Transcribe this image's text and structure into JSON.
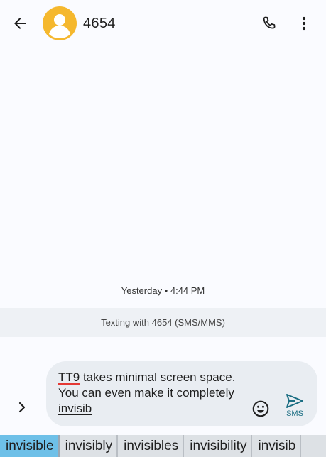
{
  "header": {
    "contact_name": "4654",
    "avatar_color": "#f5b82e",
    "icons": {
      "back": "back-arrow-icon",
      "avatar": "person-icon",
      "call": "phone-icon",
      "more": "more-vert-icon"
    }
  },
  "conversation": {
    "timestamp": "Yesterday • 4:44 PM",
    "banner": "Texting with 4654 (SMS/MMS)"
  },
  "compose": {
    "text_flagged_word": "TT9",
    "text_body": " takes minimal screen space. You can even make it completely ",
    "text_composing": "invisib",
    "send_label": "SMS",
    "accent_color": "#1b6e83",
    "icons": {
      "expand": "chevron-right-icon",
      "emoji": "emoji-icon",
      "send": "send-icon"
    }
  },
  "suggestions": {
    "items": [
      "invisible",
      "invisibly",
      "invisibles",
      "invisibility",
      "invisib"
    ],
    "selected_index": 0,
    "selected_color": "#6ec0e8"
  }
}
